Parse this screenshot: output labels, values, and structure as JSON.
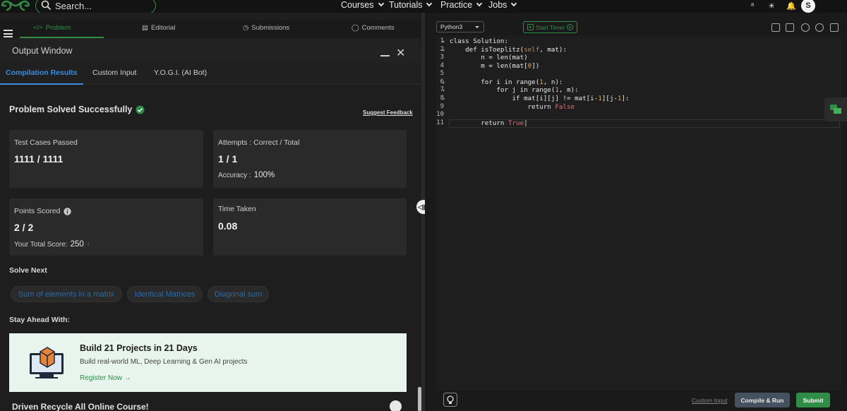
{
  "nav": {
    "search_placeholder": "Search...",
    "links": [
      "Courses",
      "Tutorials",
      "Practice",
      "Jobs"
    ],
    "avatar_initial": "S"
  },
  "problem_tabs": [
    "Problem",
    "Editorial",
    "Submissions",
    "Comments"
  ],
  "output": {
    "title": "Output Window",
    "tabs": [
      "Compilation Results",
      "Custom Input",
      "Y.O.G.I. (AI Bot)"
    ],
    "status": "Problem Solved Successfully",
    "feedback": "Suggest Feedback",
    "cards": {
      "tests_label": "Test Cases Passed",
      "tests_value": "1111 / 1111",
      "attempts_label": "Attempts : Correct / Total",
      "attempts_value": "1 / 1",
      "accuracy_label": "Accuracy :",
      "accuracy_value": "100%",
      "points_label": "Points Scored",
      "points_value": "2 / 2",
      "total_label": "Your Total Score:",
      "total_value": "250",
      "time_label": "Time Taken",
      "time_value": "0.08"
    },
    "solve_next_title": "Solve Next",
    "solve_next": [
      "Sum of elements in a matrix",
      "Identical Matrices",
      "Diagonal sum"
    ],
    "stay_ahead_title": "Stay Ahead With:",
    "promo": {
      "title": "Build 21 Projects in 21 Days",
      "desc": "Build real-world ML, Deep Learning & Gen AI projects",
      "link": "Register Now →"
    },
    "bottom_text": "Driven Recycle All Online Course!"
  },
  "editor": {
    "language": "Python3",
    "timer": "Start Timer",
    "line_numbers": [
      "1",
      "2",
      "3",
      "4",
      "5",
      "6",
      "7",
      "8",
      "9",
      "10",
      "11"
    ],
    "custom_input": "Custom Input",
    "compile": "Compile & Run",
    "submit": "Submit"
  },
  "colors": {
    "brand_green": "#2f8d46",
    "link_blue": "#3a8dde"
  }
}
